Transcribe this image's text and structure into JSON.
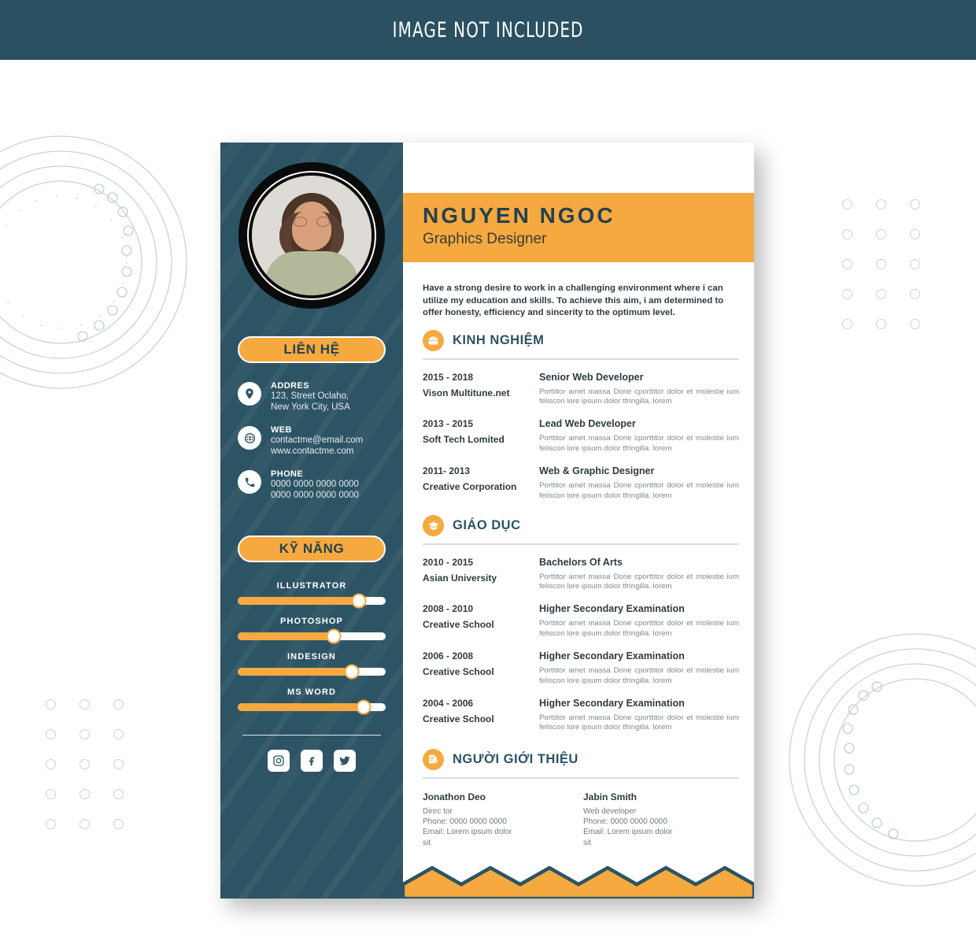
{
  "banner": {
    "text": "IMAGE NOT INCLUDED"
  },
  "colors": {
    "teal": "#2d5465",
    "banner_teal": "#2a5062",
    "orange": "#f5a93f",
    "heading_teal": "#2b5366",
    "body_text": "#2f3b42",
    "muted_text": "#7f8a90",
    "deco_line": "#c9d3da"
  },
  "profile": {
    "name": "NGUYEN NGOC",
    "title": "Graphics Designer",
    "summary": "Have a strong desire to work in a challenging environment where i can utilize my education and skills. To achieve this aim, i am determined to offer honesty, efficiency and sincerity to the optimum level."
  },
  "sidebar": {
    "contact_heading": "LIÊN HỆ",
    "skills_heading": "KỸ NĂNG",
    "contacts": [
      {
        "icon": "location-pin-icon",
        "label": "ADDRES",
        "lines": [
          "123, Street Oclaho,",
          "New York City, USA"
        ]
      },
      {
        "icon": "globe-icon",
        "label": "WEB",
        "lines": [
          "contactme@email.com",
          "www.contactme.com"
        ]
      },
      {
        "icon": "phone-icon",
        "label": "PHONE",
        "lines": [
          "0000 0000 0000 0000",
          "0000 0000 0000 0000"
        ]
      }
    ],
    "skills": [
      {
        "name": "ILLUSTRATOR",
        "value": 82
      },
      {
        "name": "PHOTOSHOP",
        "value": 65
      },
      {
        "name": "INDESIGN",
        "value": 77
      },
      {
        "name": "MS WORD",
        "value": 85
      }
    ],
    "socials": [
      {
        "icon": "instagram-icon",
        "label": "Instagram"
      },
      {
        "icon": "facebook-icon",
        "label": "Facebook"
      },
      {
        "icon": "twitter-icon",
        "label": "Twitter"
      }
    ]
  },
  "sections": {
    "experience": {
      "icon": "briefcase-icon",
      "title": "KINH NGHIỆM",
      "entries": [
        {
          "years": "2015 - 2018",
          "org": "Vison Multitune.net",
          "role": "Senior Web Developer",
          "desc": "Porttitor amet massa Done cporttitor dolor et molestie ium feliscon lore ipsum dolor tfringilla. lorem"
        },
        {
          "years": "2013 - 2015",
          "org": "Soft Tech Lomited",
          "role": "Lead Web Developer",
          "desc": "Porttitor amet massa Done cporttitor dolor et molestie ium feliscon lore ipsum dolor tfringilla. lorem"
        },
        {
          "years": "2011- 2013",
          "org": "Creative Corporation",
          "role": "Web & Graphic Designer",
          "desc": "Porttitor amet massa Done cporttitor dolor et molestie ium feliscon lore ipsum dolor tfringilla. lorem"
        }
      ]
    },
    "education": {
      "icon": "graduation-cap-icon",
      "title": "GIÁO DỤC",
      "entries": [
        {
          "years": "2010 - 2015",
          "org": "Asian University",
          "role": "Bachelors Of Arts",
          "desc": "Porttitor amet massa Done cporttitor dolor et molestie ium feliscon lore ipsum dolor tfringilla. lorem"
        },
        {
          "years": "2008 - 2010",
          "org": "Creative School",
          "role": "Higher Secondary Examination",
          "desc": "Porttitor amet massa Done cporttitor dolor et molestie ium feliscon lore ipsum dolor tfringilla. lorem"
        },
        {
          "years": "2006 - 2008",
          "org": "Creative School",
          "role": "Higher Secondary Examination",
          "desc": "Porttitor amet massa Done cporttitor dolor et molestie ium feliscon lore ipsum dolor tfringilla. lorem"
        },
        {
          "years": "2004 - 2006",
          "org": "Creative School",
          "role": "Higher Secondary Examination",
          "desc": "Porttitor amet massa Done cporttitor dolor et molestie ium feliscon lore ipsum dolor tfringilla. lorem"
        }
      ]
    },
    "references": {
      "icon": "document-edit-icon",
      "title": "NGƯỜI GIỚI THIỆU",
      "people": [
        {
          "name": "Jonathon Deo",
          "role": "Direc tor",
          "phone": "Phone: 0000 0000 0000",
          "email": "Email: Lorem ipsum dolor",
          "email2": "sit"
        },
        {
          "name": "Jabin Smith",
          "role": "Web developer",
          "phone": "Phone: 0000 0000 0000",
          "email": "Email: Lorem ipsum dolor",
          "email2": "sit"
        }
      ]
    }
  }
}
